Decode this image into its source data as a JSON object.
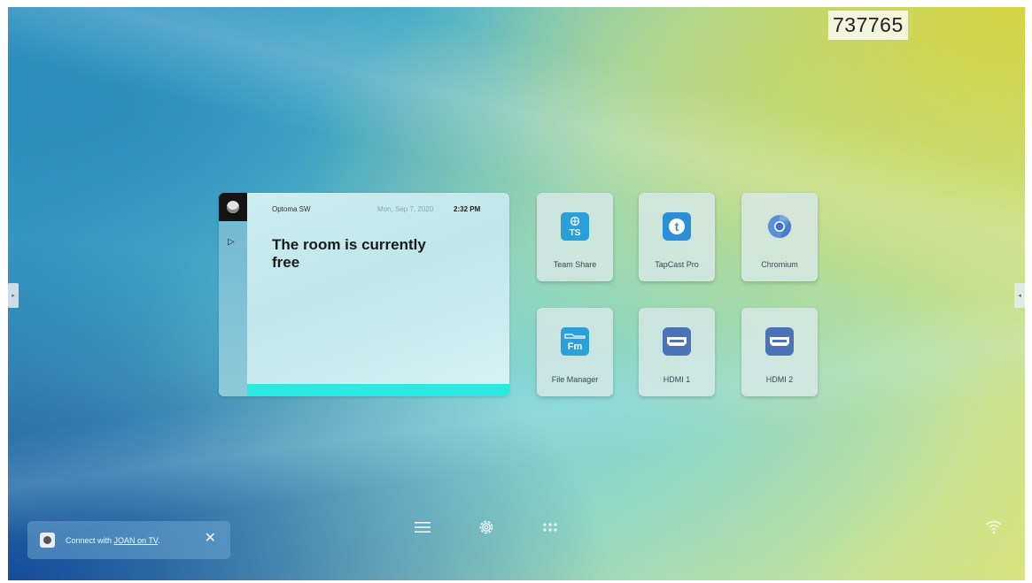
{
  "screen": {
    "code": "737765"
  },
  "room_widget": {
    "organization": "Optoma SW",
    "date": "Mon, Sep 7, 2020",
    "time": "2:32 PM",
    "status": "The room is currently free",
    "accent_color": "#2ce8e0"
  },
  "apps": [
    {
      "label": "Team Share",
      "icon": "team-share-icon",
      "glyph": "TS"
    },
    {
      "label": "TapCast Pro",
      "icon": "tapcast-icon",
      "glyph": "t"
    },
    {
      "label": "Chromium",
      "icon": "chromium-icon",
      "glyph": ""
    },
    {
      "label": "File Manager",
      "icon": "file-manager-icon",
      "glyph": "Fm"
    },
    {
      "label": "HDMI 1",
      "icon": "hdmi-icon",
      "glyph": ""
    },
    {
      "label": "HDMI 2",
      "icon": "hdmi-icon",
      "glyph": ""
    }
  ],
  "notification": {
    "prefix": "Connect with ",
    "link": "JOAN on TV",
    "suffix": "."
  },
  "dock": {
    "items": [
      "menu-icon",
      "settings-icon",
      "apps-grid-icon"
    ]
  },
  "status": {
    "wifi": "wifi-icon"
  }
}
